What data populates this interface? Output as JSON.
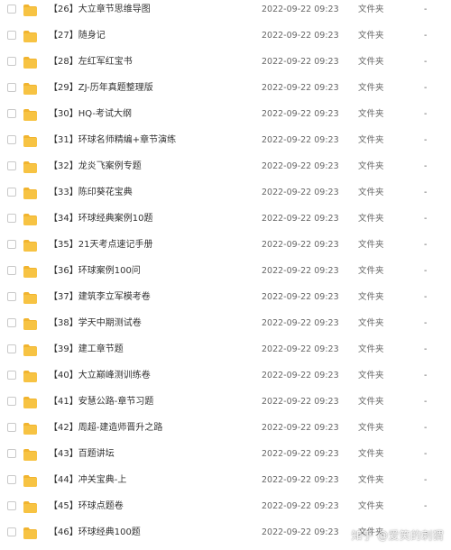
{
  "folders": [
    {
      "name": "【26】大立章节思维导图",
      "modified": "2022-09-22 09:23",
      "type": "文件夹",
      "size": "-"
    },
    {
      "name": "【27】随身记",
      "modified": "2022-09-22 09:23",
      "type": "文件夹",
      "size": "-"
    },
    {
      "name": "【28】左红军红宝书",
      "modified": "2022-09-22 09:23",
      "type": "文件夹",
      "size": "-"
    },
    {
      "name": "【29】ZJ-历年真题整理版",
      "modified": "2022-09-22 09:23",
      "type": "文件夹",
      "size": "-"
    },
    {
      "name": "【30】HQ-考试大纲",
      "modified": "2022-09-22 09:23",
      "type": "文件夹",
      "size": "-"
    },
    {
      "name": "【31】环球名师精编+章节演练",
      "modified": "2022-09-22 09:23",
      "type": "文件夹",
      "size": "-"
    },
    {
      "name": "【32】龙炎飞案例专题",
      "modified": "2022-09-22 09:23",
      "type": "文件夹",
      "size": "-"
    },
    {
      "name": "【33】陈印葵花宝典",
      "modified": "2022-09-22 09:23",
      "type": "文件夹",
      "size": "-"
    },
    {
      "name": "【34】环球经典案例10题",
      "modified": "2022-09-22 09:23",
      "type": "文件夹",
      "size": "-"
    },
    {
      "name": "【35】21天考点速记手册",
      "modified": "2022-09-22 09:23",
      "type": "文件夹",
      "size": "-"
    },
    {
      "name": "【36】环球案例100问",
      "modified": "2022-09-22 09:23",
      "type": "文件夹",
      "size": "-"
    },
    {
      "name": "【37】建筑李立军模考卷",
      "modified": "2022-09-22 09:23",
      "type": "文件夹",
      "size": "-"
    },
    {
      "name": "【38】学天中期测试卷",
      "modified": "2022-09-22 09:23",
      "type": "文件夹",
      "size": "-"
    },
    {
      "name": "【39】建工章节题",
      "modified": "2022-09-22 09:23",
      "type": "文件夹",
      "size": "-"
    },
    {
      "name": "【40】大立巅峰测训练卷",
      "modified": "2022-09-22 09:23",
      "type": "文件夹",
      "size": "-"
    },
    {
      "name": "【41】安慧公路-章节习题",
      "modified": "2022-09-22 09:23",
      "type": "文件夹",
      "size": "-"
    },
    {
      "name": "【42】周超-建造师晋升之路",
      "modified": "2022-09-22 09:23",
      "type": "文件夹",
      "size": "-"
    },
    {
      "name": "【43】百题讲坛",
      "modified": "2022-09-22 09:23",
      "type": "文件夹",
      "size": "-"
    },
    {
      "name": "【44】冲关宝典-上",
      "modified": "2022-09-22 09:23",
      "type": "文件夹",
      "size": "-"
    },
    {
      "name": "【45】环球点题卷",
      "modified": "2022-09-22 09:23",
      "type": "文件夹",
      "size": "-"
    },
    {
      "name": "【46】环球经典100题",
      "modified": "2022-09-22 09:23",
      "type": "文件夹",
      "size": "-"
    }
  ],
  "watermark": "知乎 @爱笑的刺猬",
  "colors": {
    "folder": "#f7c343",
    "folder_tab": "#f1b42f",
    "checkbox_border": "#c9c9c9",
    "text": "#333333",
    "meta_text": "#666666"
  },
  "icons": {
    "row_icon": "folder-icon",
    "selector": "checkbox"
  }
}
